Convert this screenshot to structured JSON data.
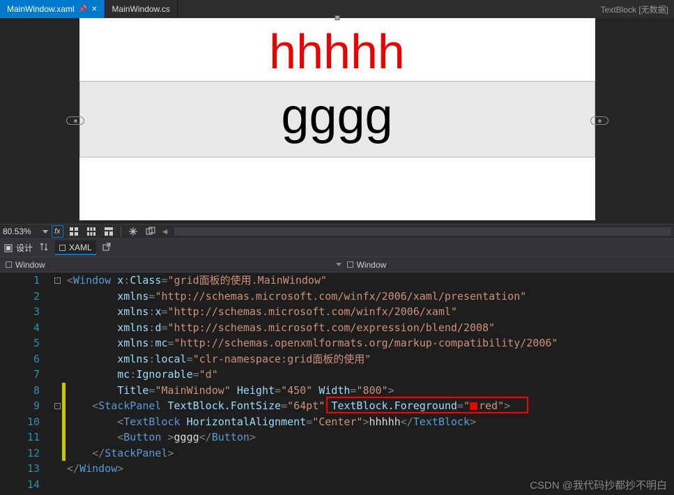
{
  "tabs": {
    "active": "MainWindow.xaml",
    "inactive": "MainWindow.cs",
    "rightInfo": "TextBlock [无数据]"
  },
  "designer": {
    "text1": "hhhhh",
    "button1": "gggg"
  },
  "zoomBar": {
    "zoom": "80.53%",
    "fx": "fx"
  },
  "splitBar": {
    "designLabel": "设计",
    "xamlLabel": "XAML"
  },
  "breadcrumb": {
    "left": "Window",
    "right": "Window"
  },
  "code": {
    "lineNumbers": [
      "1",
      "2",
      "3",
      "4",
      "5",
      "6",
      "7",
      "8",
      "9",
      "10",
      "11",
      "12",
      "13",
      "14"
    ],
    "l1": {
      "p1": "<",
      "tag": "Window",
      "sp": " ",
      "a1": "x",
      "c": ":",
      "a2": "Class",
      "eq": "=",
      "v": "\"grid面板的使用.MainWindow\""
    },
    "l2": {
      "a": "xmlns",
      "eq": "=",
      "v": "\"http://schemas.microsoft.com/winfx/2006/xaml/presentation\""
    },
    "l3": {
      "a1": "xmlns",
      "c": ":",
      "a2": "x",
      "eq": "=",
      "v": "\"http://schemas.microsoft.com/winfx/2006/xaml\""
    },
    "l4": {
      "a1": "xmlns",
      "c": ":",
      "a2": "d",
      "eq": "=",
      "v": "\"http://schemas.microsoft.com/expression/blend/2008\""
    },
    "l5": {
      "a1": "xmlns",
      "c": ":",
      "a2": "mc",
      "eq": "=",
      "v": "\"http://schemas.openxmlformats.org/markup-compatibility/2006\""
    },
    "l6": {
      "a1": "xmlns",
      "c": ":",
      "a2": "local",
      "eq": "=",
      "v": "\"clr-namespace:grid面板的使用\""
    },
    "l7": {
      "a1": "mc",
      "c": ":",
      "a2": "Ignorable",
      "eq": "=",
      "v": "\"d\""
    },
    "l8": {
      "a1": "Title",
      "eq": "=",
      "v1": "\"MainWindow\"",
      "a2": "Height",
      "v2": "\"450\"",
      "a3": "Width",
      "v3": "\"800\"",
      "end": ">"
    },
    "l9": {
      "p1": "<",
      "tag": "StackPanel",
      "a1": "TextBlock.FontSize",
      "eq": "=",
      "v1": "\"64pt\"",
      "a2": "TextBlock.Foreground",
      "v2q1": "\"",
      "v2": "red",
      "v2q2": "\"",
      "end": ">"
    },
    "l10": {
      "p1": "<",
      "tag": "TextBlock",
      "a1": "HorizontalAlignment",
      "eq": "=",
      "v1": "\"Center\"",
      "gt": ">",
      "txt": "hhhhh",
      "p2": "</",
      "tag2": "TextBlock",
      "end": ">"
    },
    "l11": {
      "p1": "<",
      "tag": "Button",
      "sp": " ",
      "gt": ">",
      "txt": "gggg",
      "p2": "</",
      "tag2": "Button",
      "end": ">"
    },
    "l12": {
      "p1": "</",
      "tag": "StackPanel",
      "end": ">"
    },
    "l13": {
      "p1": "</",
      "tag": "Window",
      "end": ">"
    }
  },
  "watermark": "CSDN @我代码抄都抄不明白"
}
